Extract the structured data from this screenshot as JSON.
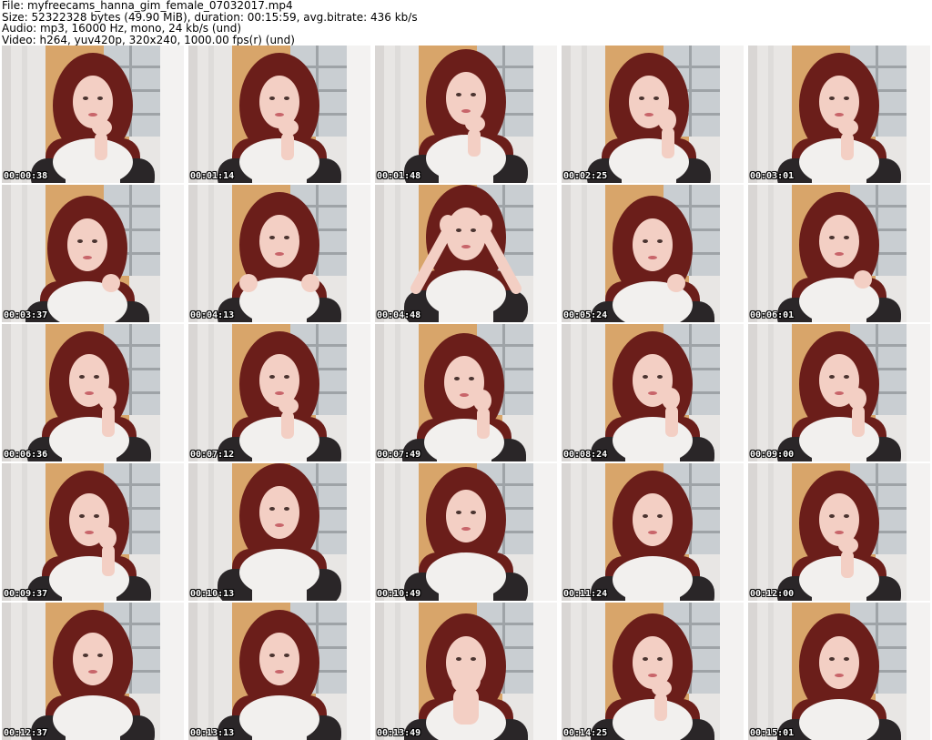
{
  "header": {
    "file_line": "File: myfreecams_hanna_gim_female_07032017.mp4",
    "size_line": "Size: 52322328 bytes (49.90 MiB), duration: 00:15:59, avg.bitrate: 436 kb/s",
    "audio_line": "Audio: mp3, 16000 Hz, mono, 24 kb/s (und)",
    "video_line": "Video: h264, yuv420p, 320x240, 1000.00 fps(r) (und)"
  },
  "colors": {
    "background": "#ffffff",
    "curtain": "#e8e6e4",
    "wall": "#d8a56a",
    "window": "#c9ced2",
    "hair": "#6b1e1a",
    "skin": "#f3cfc4",
    "scarf": "#f2f0ee",
    "sweater": "#2a2628"
  },
  "thumbnails": [
    {
      "time": "00:00:38"
    },
    {
      "time": "00:01:14"
    },
    {
      "time": "00:01:48"
    },
    {
      "time": "00:02:25"
    },
    {
      "time": "00:03:01"
    },
    {
      "time": "00:03:37"
    },
    {
      "time": "00:04:13"
    },
    {
      "time": "00:04:48"
    },
    {
      "time": "00:05:24"
    },
    {
      "time": "00:06:01"
    },
    {
      "time": "00:06:36"
    },
    {
      "time": "00:07:12"
    },
    {
      "time": "00:07:49"
    },
    {
      "time": "00:08:24"
    },
    {
      "time": "00:09:00"
    },
    {
      "time": "00:09:37"
    },
    {
      "time": "00:10:13"
    },
    {
      "time": "00:10:49"
    },
    {
      "time": "00:11:24"
    },
    {
      "time": "00:12:00"
    },
    {
      "time": "00:12:37"
    },
    {
      "time": "00:13:13"
    },
    {
      "time": "00:13:49"
    },
    {
      "time": "00:14:25"
    },
    {
      "time": "00:15:01"
    }
  ]
}
